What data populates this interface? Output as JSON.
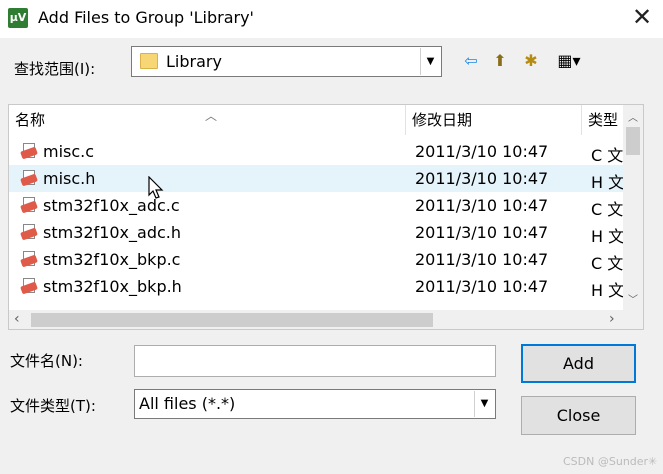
{
  "window": {
    "app_icon_text": "µV",
    "title": "Add Files to Group 'Library'",
    "close_glyph": "✕"
  },
  "lookin": {
    "label": "查找范围(I):",
    "value": "Library"
  },
  "toolbar": {
    "back_glyph": "⇦",
    "up_glyph": "⬆",
    "new_folder_glyph": "✱",
    "view_glyph": "▦▾"
  },
  "list": {
    "columns": [
      "名称",
      "修改日期",
      "类型"
    ],
    "rows": [
      {
        "name": "misc.c",
        "date": "2011/3/10 10:47",
        "type": "C 文"
      },
      {
        "name": "misc.h",
        "date": "2011/3/10 10:47",
        "type": "H 文"
      },
      {
        "name": "stm32f10x_adc.c",
        "date": "2011/3/10 10:47",
        "type": "C 文"
      },
      {
        "name": "stm32f10x_adc.h",
        "date": "2011/3/10 10:47",
        "type": "H 文"
      },
      {
        "name": "stm32f10x_bkp.c",
        "date": "2011/3/10 10:47",
        "type": "C 文"
      },
      {
        "name": "stm32f10x_bkp.h",
        "date": "2011/3/10 10:47",
        "type": "H 文"
      }
    ]
  },
  "filename": {
    "label": "文件名(N):",
    "value": ""
  },
  "filetype": {
    "label": "文件类型(T):",
    "value": "All files (*.*)"
  },
  "buttons": {
    "add": "Add",
    "close": "Close"
  },
  "watermark": "CSDN @Sunder✳"
}
